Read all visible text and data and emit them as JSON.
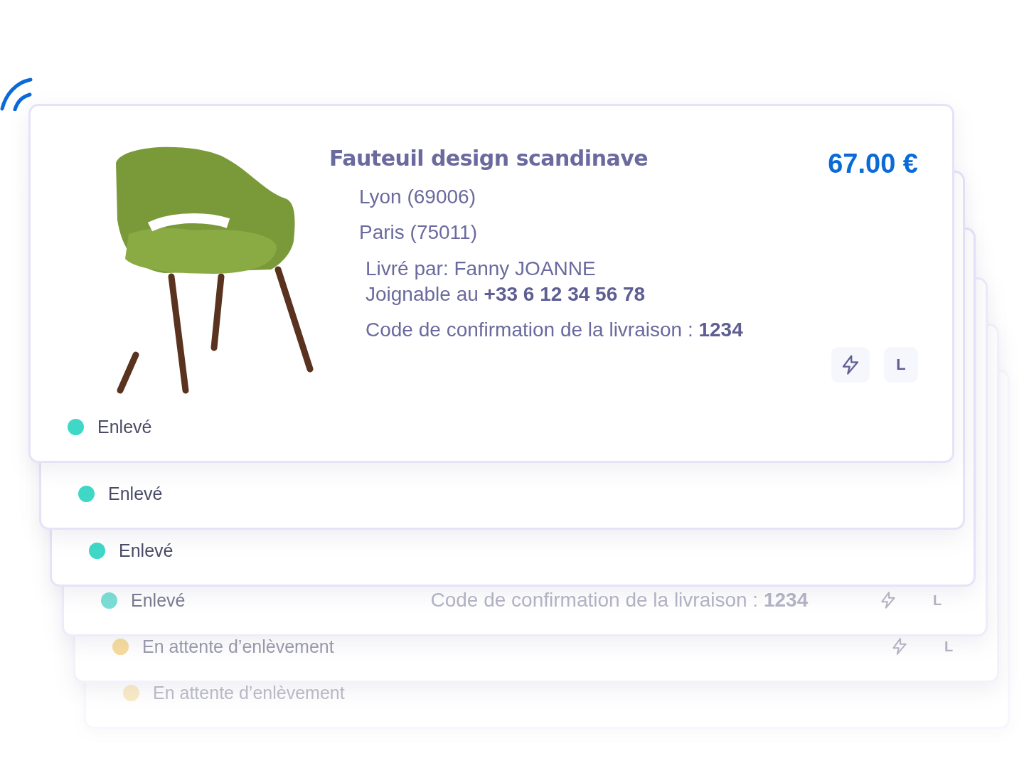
{
  "cards": [
    {
      "title": "Fauteuil design scandinave",
      "price": "67.00 €",
      "pickup": "Lyon (69006)",
      "dropoff": "Paris (75011)",
      "courier_line": "Livré par: Fanny JOANNE",
      "phone_line": "Joignable au **+33 6 12 34 56 78**",
      "confirmation": "Code de confirmation de la livraison : **1234**",
      "badges": [
        {
          "kind": "bolt"
        },
        {
          "kind": "letter",
          "label": "L"
        }
      ],
      "status": {
        "label": "Enlevé",
        "color": "#3fd8c6"
      }
    },
    {
      "status": {
        "label": "Enlevé",
        "color": "#3fd8c6"
      }
    },
    {
      "status": {
        "label": "Enlevé",
        "color": "#3fd8c6"
      }
    },
    {
      "confirmation": "Code de confirmation de la livraison : **1234**",
      "badges": [
        {
          "kind": "bolt"
        },
        {
          "kind": "letter",
          "label": "L"
        }
      ],
      "status": {
        "label": "Enlevé",
        "color": "#7adfd6"
      }
    },
    {
      "badges": [
        {
          "kind": "bolt"
        },
        {
          "kind": "letter",
          "label": "L"
        }
      ],
      "status": {
        "label": "En attente d’enlèvement",
        "color": "#f7dc9c"
      }
    },
    {
      "status": {
        "label": "En attente d’enlèvement",
        "color": "#fbecc6"
      }
    }
  ]
}
